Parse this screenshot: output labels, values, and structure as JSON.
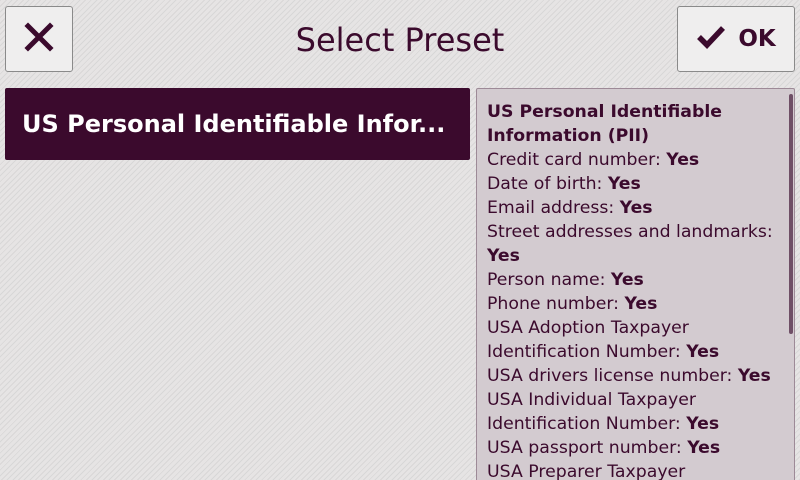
{
  "header": {
    "title": "Select Preset",
    "close_icon": "close-x-icon",
    "ok_icon": "checkmark-icon",
    "ok_label": "OK"
  },
  "presets": [
    {
      "label": "US Personal Identifiable Infor..."
    }
  ],
  "details": {
    "title": "US Personal Identifiable Information (PII)",
    "items": [
      {
        "label": "Credit card number: ",
        "value": "Yes"
      },
      {
        "label": "Date of birth: ",
        "value": "Yes"
      },
      {
        "label": "Email address: ",
        "value": "Yes"
      },
      {
        "label": "Street addresses and landmarks: ",
        "value": "Yes"
      },
      {
        "label": "Person name: ",
        "value": "Yes"
      },
      {
        "label": "Phone number: ",
        "value": "Yes"
      },
      {
        "label": "USA Adoption Taxpayer Identification Number: ",
        "value": "Yes"
      },
      {
        "label": "USA drivers license number: ",
        "value": "Yes"
      },
      {
        "label": "USA Individual Taxpayer Identification Number: ",
        "value": "Yes"
      },
      {
        "label": "USA passport number: ",
        "value": "Yes"
      },
      {
        "label": "USA Preparer Taxpayer",
        "value": ""
      }
    ]
  },
  "colors": {
    "accent": "#3b0a2d",
    "background": "#e6e4e4",
    "panel": "#d3cbd0"
  }
}
